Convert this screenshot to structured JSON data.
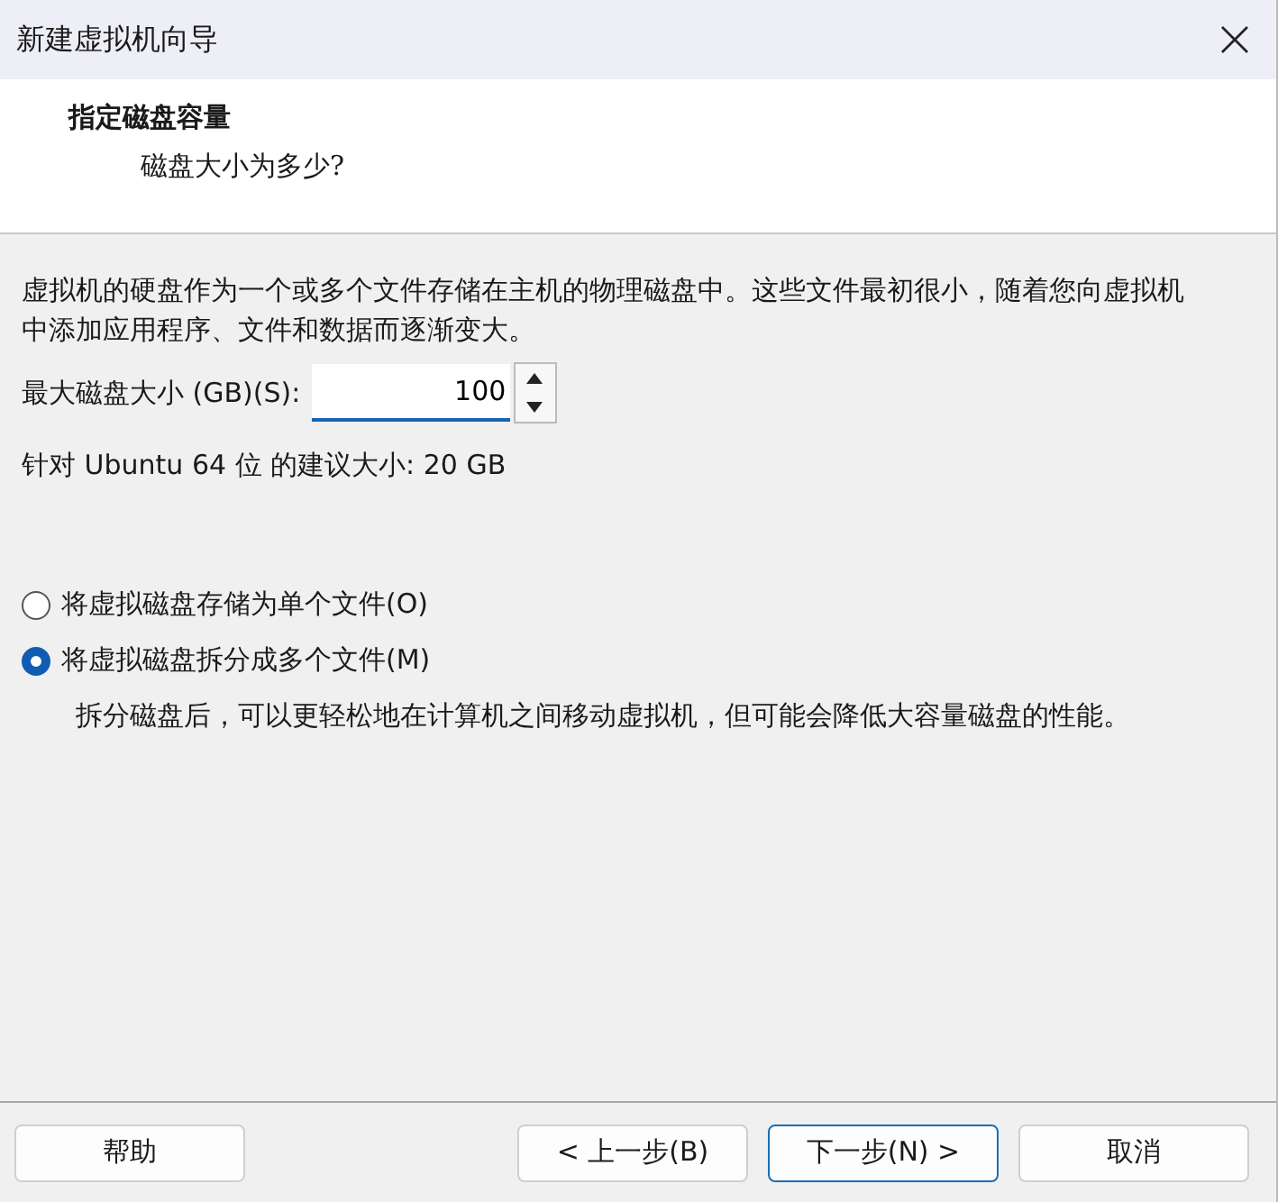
{
  "window": {
    "title": "新建虚拟机向导"
  },
  "header": {
    "title": "指定磁盘容量",
    "subtitle": "磁盘大小为多少?"
  },
  "description": "虚拟机的硬盘作为一个或多个文件存储在主机的物理磁盘中。这些文件最初很小，随着您向虚拟机中添加应用程序、文件和数据而逐渐变大。",
  "disk_size": {
    "label": "最大磁盘大小 (GB)(S):",
    "value": "100"
  },
  "recommendation": "针对 Ubuntu 64 位 的建议大小: 20 GB",
  "options": [
    {
      "label": "将虚拟磁盘存储为单个文件(O)",
      "selected": false
    },
    {
      "label": "将虚拟磁盘拆分成多个文件(M)",
      "selected": true,
      "note": "拆分磁盘后，可以更轻松地在计算机之间移动虚拟机，但可能会降低大容量磁盘的性能。"
    }
  ],
  "buttons": [
    {
      "label": "帮助",
      "kind": "plain"
    },
    {
      "label": "< 上一步(B)",
      "kind": "plain"
    },
    {
      "label": "下一步(N) >",
      "kind": "default"
    },
    {
      "label": "取消",
      "kind": "plain"
    }
  ]
}
